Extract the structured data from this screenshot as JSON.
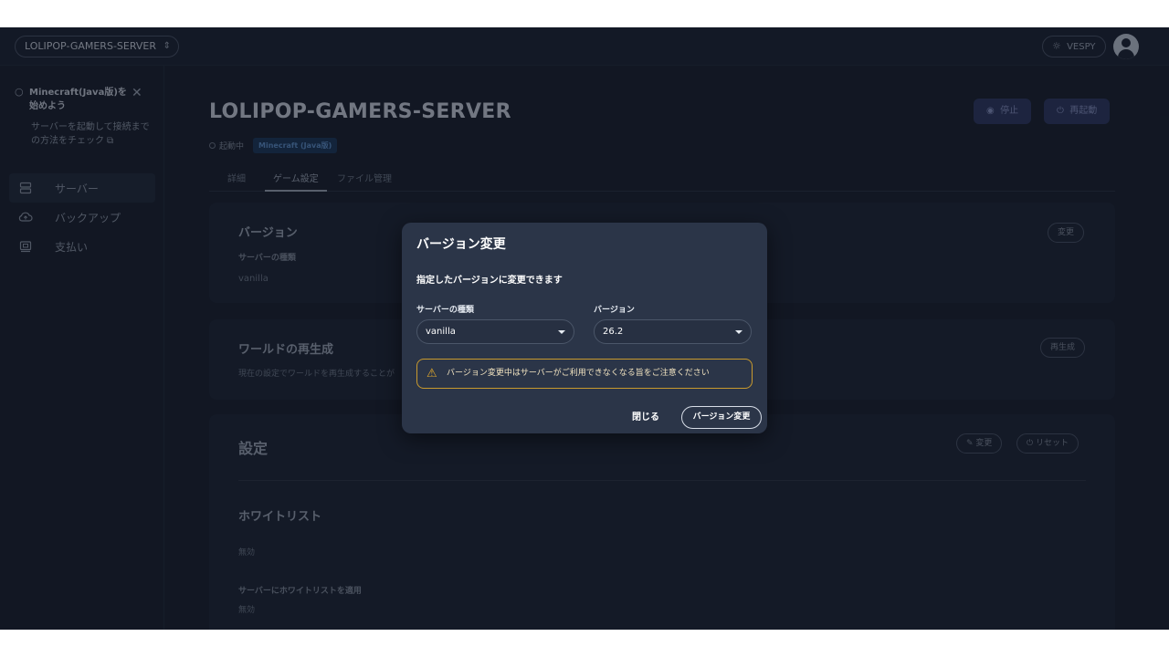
{
  "topbar": {
    "server_name": "LOLIPOP-GAMERS-SERVER",
    "user_name": "VESPY"
  },
  "sidebar": {
    "tip": {
      "title": "Minecraft(Java版)を始めよう",
      "body": "サーバーを起動して接続までの方法をチェック"
    },
    "items": [
      {
        "label": "サーバー",
        "icon": "server-icon",
        "active": true
      },
      {
        "label": "バックアップ",
        "icon": "cloud-upload-icon",
        "active": false
      },
      {
        "label": "支払い",
        "icon": "payment-icon",
        "active": false
      }
    ]
  },
  "main": {
    "title": "LOLIPOP-GAMERS-SERVER",
    "status": "起動中",
    "badge": "Minecraft (Java版)",
    "stop_label": "停止",
    "restart_label": "再起動",
    "tabs": [
      "詳細",
      "ゲーム設定",
      "ファイル管理"
    ],
    "version_card": {
      "title": "バージョン",
      "label": "サーバーの種類",
      "value": "vanilla",
      "button": "変更"
    },
    "world_card": {
      "title": "ワールドの再生成",
      "desc": "現在の設定でワールドを再生成することが",
      "button": "再生成"
    },
    "settings_card": {
      "title": "設定",
      "edit_button": "変更",
      "reset_button": "リセット",
      "whitelist_title": "ホワイトリスト",
      "whitelist_value": "無効",
      "apply_label": "サーバーにホワイトリストを適用",
      "apply_value": "無効"
    }
  },
  "modal": {
    "title": "バージョン変更",
    "description": "指定したバージョンに変更できます",
    "type_label": "サーバーの種類",
    "type_value": "vanilla",
    "version_label": "バージョン",
    "version_value": "26.2",
    "warning": "バージョン変更中はサーバーがご利用できなくなる旨をご注意ください",
    "close_label": "閉じる",
    "confirm_label": "バージョン変更"
  },
  "colors": {
    "background": "#1a2230",
    "modal": "#2b3548",
    "warning": "#c99a2e",
    "badge": "#1d3a5c"
  }
}
